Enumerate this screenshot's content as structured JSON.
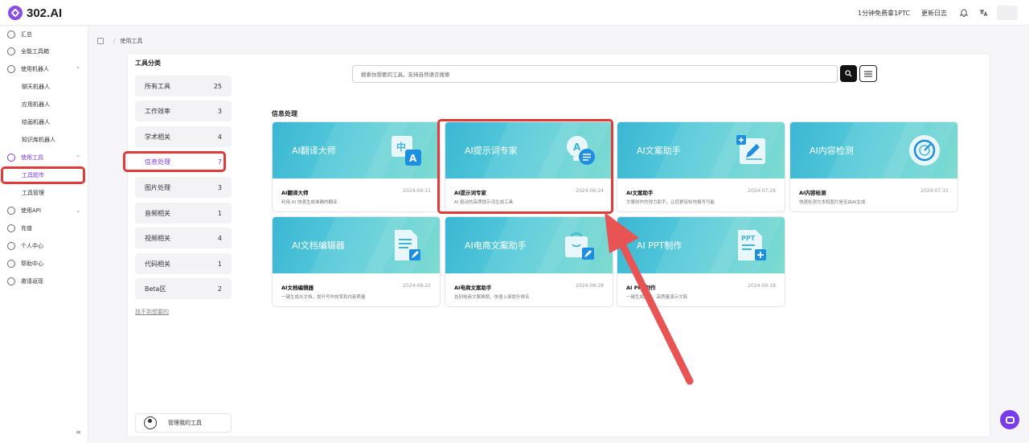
{
  "app": {
    "logo_text": "302.AI"
  },
  "header": {
    "promo_link": "1分钟免费拿1PTC",
    "changelog": "更新日志",
    "bell_icon": "bell-icon",
    "lang_icon": "translate-icon"
  },
  "sidebar": {
    "items": [
      {
        "label": "汇总",
        "icon": "dashboard-icon"
      },
      {
        "label": "全能工具箱",
        "icon": "toolbox-icon"
      },
      {
        "label": "使用机器人",
        "icon": "robot-icon",
        "chevron": "⌃"
      },
      {
        "label": "聊天机器人"
      },
      {
        "label": "应用机器人"
      },
      {
        "label": "绘画机器人"
      },
      {
        "label": "知识库机器人"
      },
      {
        "label": "使用工具",
        "icon": "tools-icon",
        "chevron": "⌃"
      },
      {
        "label": "工具超市"
      },
      {
        "label": "工具管理"
      },
      {
        "label": "使用API",
        "icon": "api-icon",
        "chevron": "⌄"
      },
      {
        "label": "充值",
        "icon": "wallet-icon"
      },
      {
        "label": "个人中心",
        "icon": "user-icon"
      },
      {
        "label": "帮助中心",
        "icon": "help-icon"
      },
      {
        "label": "邀请返现",
        "icon": "gift-icon"
      }
    ],
    "collapse_icon": "≡"
  },
  "breadcrumb": {
    "current": "使用工具"
  },
  "categories": {
    "title": "工具分类",
    "items": [
      {
        "label": "所有工具",
        "count": "25"
      },
      {
        "label": "工作效率",
        "count": "3"
      },
      {
        "label": "学术相关",
        "count": "4"
      },
      {
        "label": "信息处理",
        "count": "7"
      },
      {
        "label": "图片处理",
        "count": "3"
      },
      {
        "label": "音频相关",
        "count": "1"
      },
      {
        "label": "视频相关",
        "count": "4"
      },
      {
        "label": "代码相关",
        "count": "1"
      },
      {
        "label": "Beta区",
        "count": "2"
      }
    ],
    "not_found_link": "找不到想要的",
    "manage_label": "管理我的工具"
  },
  "search": {
    "placeholder": "搜索你想要的工具，支持自然语言搜索"
  },
  "section": {
    "title": "信息处理"
  },
  "cards": [
    {
      "banner": "AI翻译大师",
      "name": "AI翻译大师",
      "date": "2024-04-11",
      "desc": "利用 AI 快速生成准确的翻译",
      "icon": "translate-icon"
    },
    {
      "banner": "AI提示词专家",
      "name": "AI提示词专家",
      "date": "2024-06-24",
      "desc": "AI 驱动的高质提示词生成工具",
      "icon": "prompt-icon"
    },
    {
      "banner": "AI文案助手",
      "name": "AI文案助手",
      "date": "2024-07-26",
      "desc": "文案创作的得力助手，让您更轻松地撰写可能",
      "icon": "edit-icon"
    },
    {
      "banner": "AI内容检测",
      "name": "AI内容检测",
      "date": "2024-07-31",
      "desc": "快速检测文本和图片是否由AI生成",
      "icon": "radar-icon"
    },
    {
      "banner": "AI文档编辑器",
      "name": "AI文档编辑器",
      "date": "2024-08-22",
      "desc": "一键生成长文档，提升写作效率和内容质量",
      "icon": "document-icon"
    },
    {
      "banner": "AI电商文案助手",
      "name": "AI电商文案助手",
      "date": "2024-08-28",
      "desc": "告别电商文案难题，快速上架提升排名",
      "icon": "shopping-bag-icon"
    },
    {
      "banner": "AI PPT制作",
      "name": "AI PPT制作",
      "date": "2024-09-18",
      "desc": "一键生成PPT，高质量演示文稿",
      "icon": "ppt-icon"
    }
  ],
  "colors": {
    "accent": "#7c3aed",
    "highlight": "#e03b3b",
    "banner_from": "#3bb6d4",
    "banner_to": "#7fdcd0"
  }
}
